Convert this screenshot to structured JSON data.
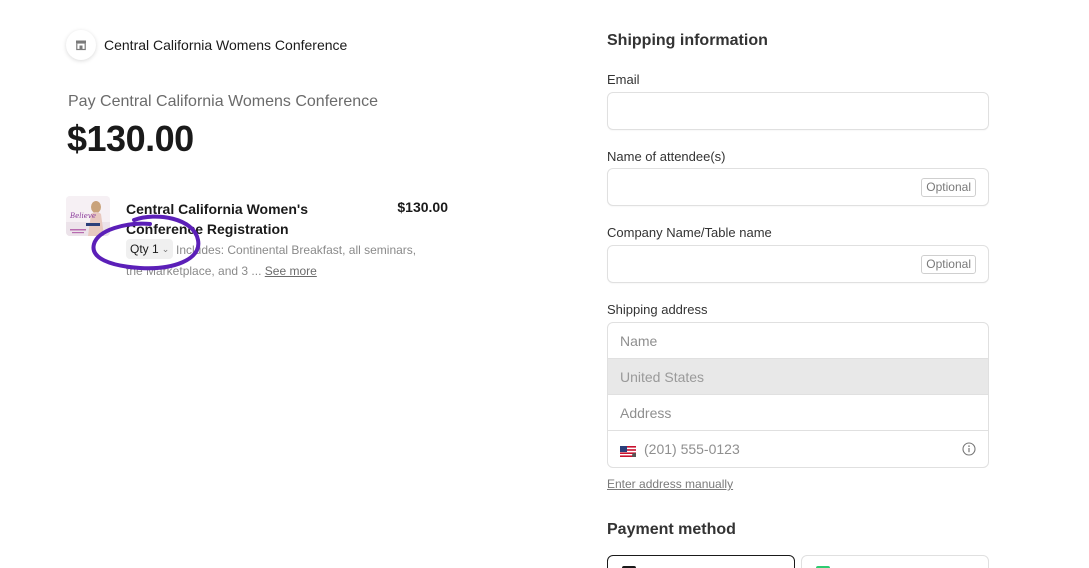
{
  "merchant": {
    "name": "Central California Womens Conference",
    "icon": "storefront-icon"
  },
  "summary": {
    "pay_label": "Pay Central California Womens Conference",
    "amount": "$130.00"
  },
  "line_item": {
    "name": "Central California Women's Conference Registration",
    "price": "$130.00",
    "qty_label": "Qty 1",
    "description": "Includes: Continental Breakfast, all seminars, the Marketplace, and 3 ...",
    "see_more": "See more",
    "thumbnail_text": "Believe"
  },
  "annotation": {
    "color": "#5b1fb8"
  },
  "shipping": {
    "title": "Shipping information",
    "email_label": "Email",
    "attendee_label": "Name of attendee(s)",
    "company_label": "Company Name/Table name",
    "optional_badge": "Optional",
    "address_label": "Shipping address",
    "name_placeholder": "Name",
    "country_value": "United States",
    "address_placeholder": "Address",
    "phone_placeholder": "(201) 555-0123",
    "manual_link": "Enter address manually"
  },
  "payment": {
    "title": "Payment method",
    "tab_colors": [
      "#1a1a1a",
      "#2ecc71"
    ]
  },
  "colors": {
    "text_primary": "#1a1a1a",
    "text_muted": "#6b6b6b",
    "border": "#e0e0e0",
    "country_bg": "#e8e8e8"
  }
}
